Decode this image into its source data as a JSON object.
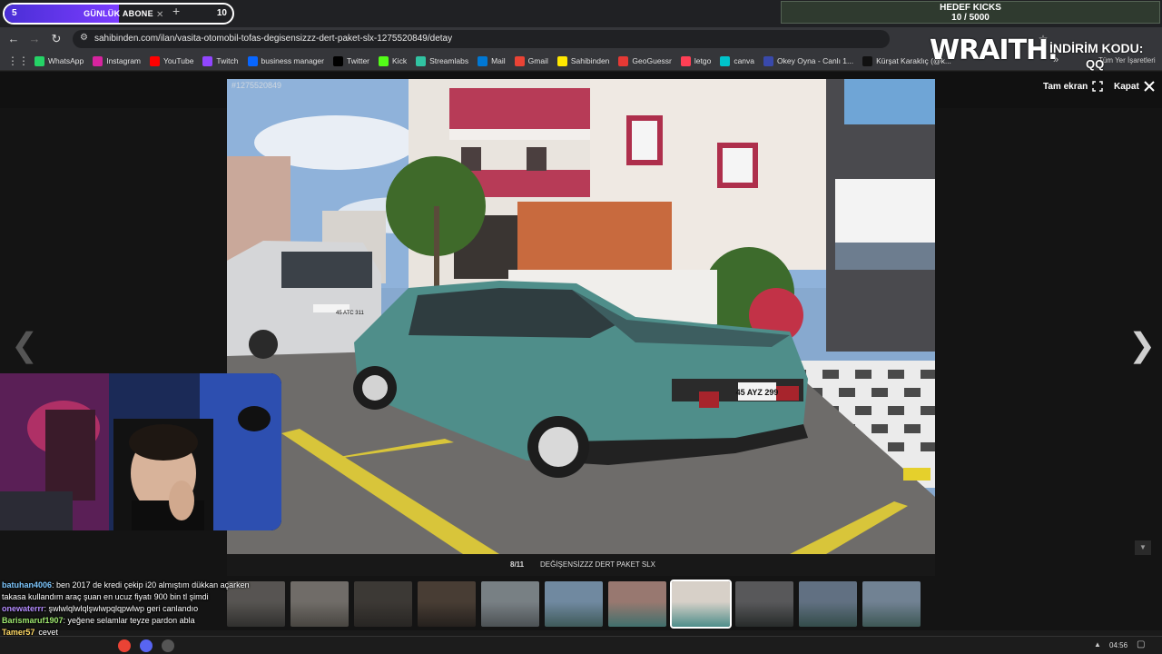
{
  "tabstrip": {
    "goal_left": "5",
    "goal_title": "GÜNLÜK ABONE",
    "goal_right": "10",
    "goal_fill_fraction": 0.5
  },
  "kick_goal": {
    "title": "HEDEF KICKS",
    "progress": "10 / 5000"
  },
  "address_bar": {
    "url": "sahibinden.com/ilan/vasita-otomobil-tofas-degisensizzz-dert-paket-slx-1275520849/detay"
  },
  "bookmarks": [
    {
      "label": "WhatsApp",
      "icon": "whatsapp-icon",
      "color": "#25d366"
    },
    {
      "label": "Instagram",
      "icon": "instagram-icon",
      "color": "#d6249f"
    },
    {
      "label": "YouTube",
      "icon": "youtube-icon",
      "color": "#ff0000"
    },
    {
      "label": "Twitch",
      "icon": "twitch-icon",
      "color": "#9146ff"
    },
    {
      "label": "business manager",
      "icon": "meta-icon",
      "color": "#0866ff"
    },
    {
      "label": "Twitter",
      "icon": "x-icon",
      "color": "#000000"
    },
    {
      "label": "Kick",
      "icon": "kick-icon",
      "color": "#53fc18"
    },
    {
      "label": "Streamlabs",
      "icon": "streamlabs-icon",
      "color": "#31c3a2"
    },
    {
      "label": "Mail",
      "icon": "mail-icon",
      "color": "#0078d4"
    },
    {
      "label": "Gmail",
      "icon": "gmail-icon",
      "color": "#ea4335"
    },
    {
      "label": "Sahibinden",
      "icon": "sahibinden-icon",
      "color": "#ffe800"
    },
    {
      "label": "GeoGuessr",
      "icon": "pin-icon",
      "color": "#e53935"
    },
    {
      "label": "letgo",
      "icon": "letgo-icon",
      "color": "#ff3f55"
    },
    {
      "label": "canva",
      "icon": "canva-icon",
      "color": "#00c4cc"
    },
    {
      "label": "Okey Oyna - Canlı 1...",
      "icon": "okey-icon",
      "color": "#3949ab"
    },
    {
      "label": "Kürşat Karaklıç (@k...",
      "icon": "tiktok-icon",
      "color": "#111111"
    }
  ],
  "bookmarks_all": "Tüm Yer İşaretleri",
  "sponsor": {
    "brand": "WRAITH.",
    "promo_label": "İNDİRİM KODU:",
    "promo_code": "QQ"
  },
  "gallery": {
    "fullscreen_label": "Tam ekran",
    "close_label": "Kapat",
    "photo_id": "#1275520849",
    "counter": "8/11",
    "caption": "DEĞİŞENSİZZZ DERT PAKET SLX",
    "plate_main": "45 AYZ 299",
    "plate_van": "45 ATC 311",
    "thumbnail_count": 11,
    "active_thumbnail_index": 7
  },
  "chat": [
    {
      "user": "batuhan4006",
      "message": ": ben 2017 de kredi çekip i20 almıştım dükkan açarken takasa kullandım araç şuan en ucuz fiyatı 900 bin tl şimdi",
      "color": "#7ec8ff"
    },
    {
      "user": "onewaterrr",
      "message": ": şwlwlqlwlqlşwlwpqlqpwlwp geri canlandıo",
      "color": "#b58cff"
    },
    {
      "user": "Barismaruf1907",
      "message": ": yeğene selamlar teyze pardon abla",
      "color": "#9fe870"
    },
    {
      "user": "Tamer57",
      "message": "cevet",
      "color": "#ffd966"
    }
  ],
  "taskbar": {
    "time": "04:56"
  }
}
